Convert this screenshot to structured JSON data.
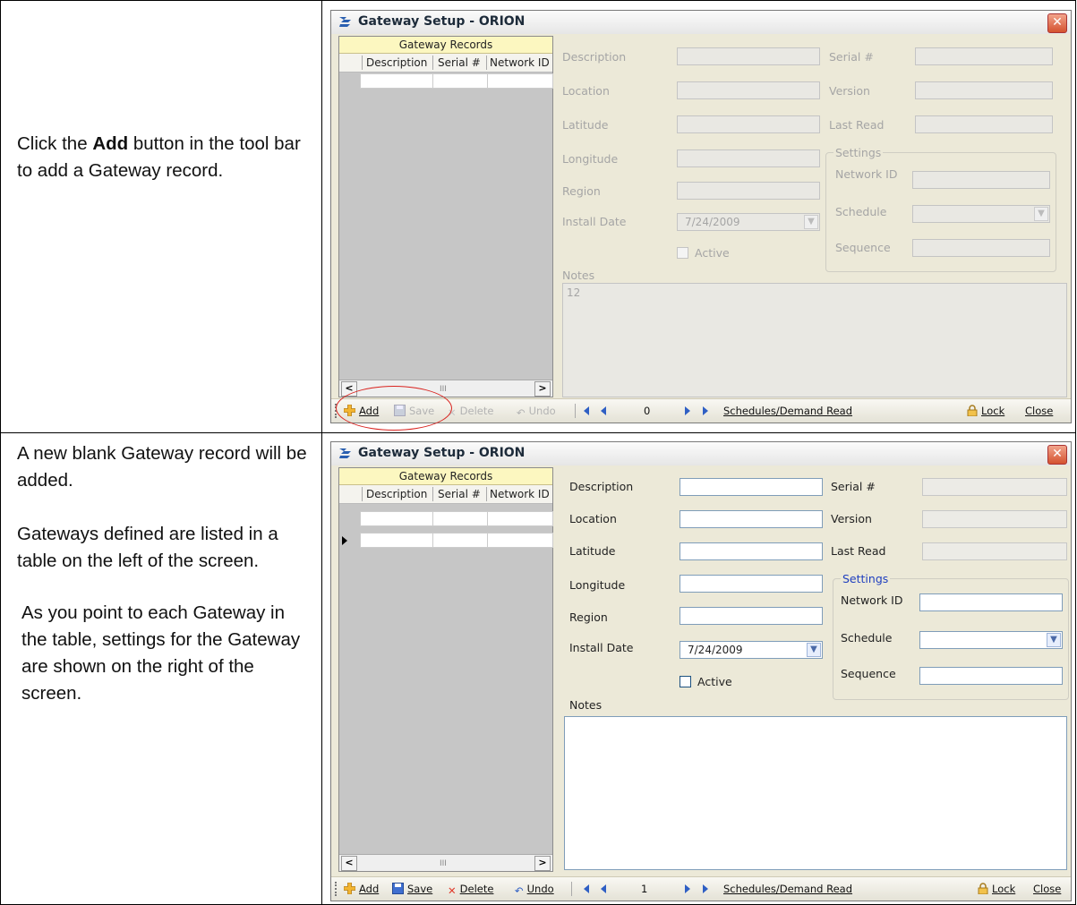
{
  "steps": [
    {
      "instruction_prefix": "Click the ",
      "instruction_bold": "Add",
      "instruction_suffix": " button in the tool bar to add a Gateway record.",
      "window": {
        "title": "Gateway Setup - ORION",
        "close_glyph": "✕",
        "grid": {
          "caption": "Gateway Records",
          "columns": [
            "Description",
            "Serial #",
            "Network ID"
          ],
          "scroll_left": "<",
          "scroll_right": ">",
          "scroll_thumb": "III"
        },
        "form": {
          "description_label": "Description",
          "location_label": "Location",
          "latitude_label": "Latitude",
          "longitude_label": "Longitude",
          "region_label": "Region",
          "install_date_label": "Install Date",
          "install_date_value": "7/24/2009",
          "active_label": "Active",
          "notes_label": "Notes",
          "notes_value": "12",
          "serial_label": "Serial #",
          "version_label": "Version",
          "last_read_label": "Last Read",
          "settings_legend": "Settings",
          "network_id_label": "Network ID",
          "schedule_label": "Schedule",
          "sequence_label": "Sequence"
        },
        "toolbar": {
          "add": "Add",
          "save": "Save",
          "delete": "Delete",
          "undo": "Undo",
          "record_number": "0",
          "schedules": "Schedules/Demand Read",
          "lock": "Lock",
          "close": "Close"
        }
      }
    },
    {
      "instruction_lines": [
        "A new blank Gateway record will be added.",
        "Gateways defined are listed in a table on the left of the screen.",
        "As you point to each Gateway in the table, settings for the Gateway are shown on the right of the screen."
      ],
      "window": {
        "title": "Gateway Setup - ORION",
        "close_glyph": "✕",
        "grid": {
          "caption": "Gateway Records",
          "columns": [
            "Description",
            "Serial #",
            "Network ID"
          ],
          "scroll_left": "<",
          "scroll_right": ">",
          "scroll_thumb": "III"
        },
        "form": {
          "description_label": "Description",
          "location_label": "Location",
          "latitude_label": "Latitude",
          "longitude_label": "Longitude",
          "region_label": "Region",
          "install_date_label": "Install Date",
          "install_date_value": "7/24/2009",
          "active_label": "Active",
          "notes_label": "Notes",
          "serial_label": "Serial #",
          "version_label": "Version",
          "last_read_label": "Last Read",
          "settings_legend": "Settings",
          "network_id_label": "Network ID",
          "schedule_label": "Schedule",
          "sequence_label": "Sequence"
        },
        "toolbar": {
          "add": "Add",
          "save": "Save",
          "delete": "Delete",
          "undo": "Undo",
          "record_number": "1",
          "schedules": "Schedules/Demand Read",
          "lock": "Lock",
          "close": "Close"
        }
      }
    }
  ],
  "colors": {
    "add_highlight_circle": "#d9231f",
    "grid_caption_bg": "#fcf7c0",
    "settings_legend": "#1f3fbf",
    "window_bg": "#ece9d8"
  },
  "icons": [
    "app-logo-icon",
    "close-icon",
    "add-icon",
    "save-icon",
    "delete-icon",
    "undo-icon",
    "first-record-icon",
    "previous-record-icon",
    "next-record-icon",
    "last-record-icon",
    "lock-icon",
    "dropdown-arrow-icon",
    "row-pointer-icon"
  ]
}
